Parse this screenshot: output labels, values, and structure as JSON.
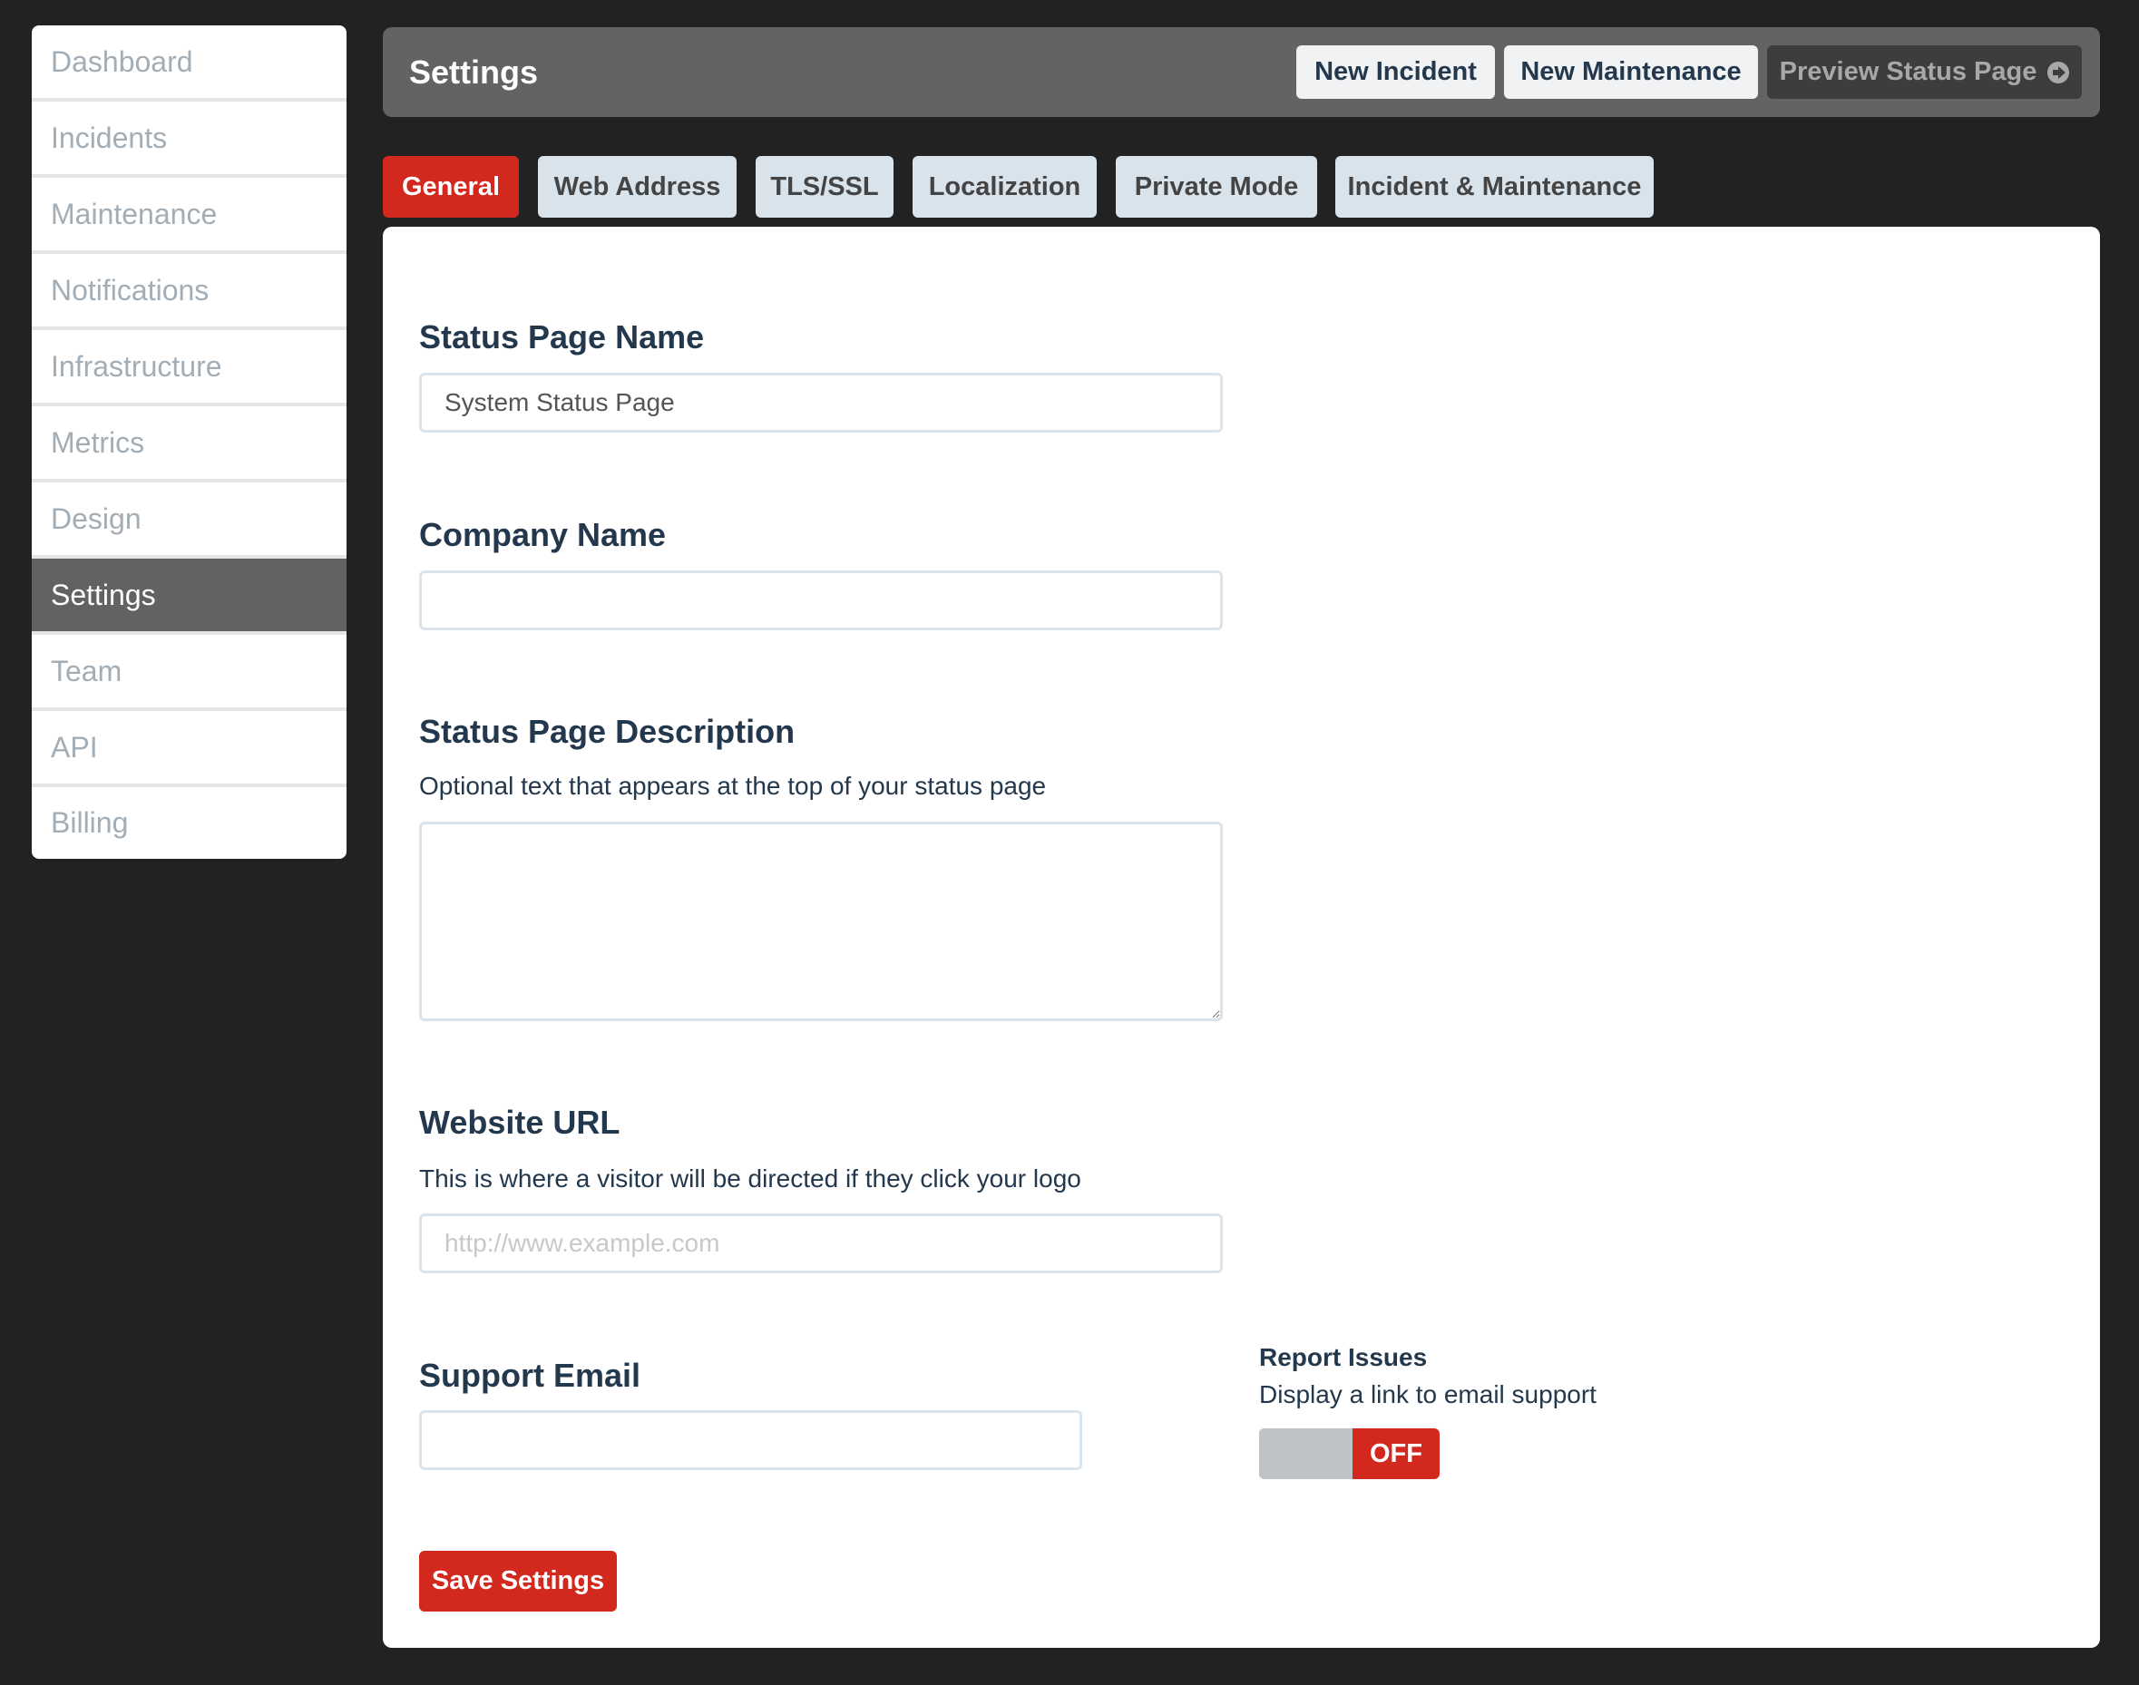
{
  "sidebar": {
    "items": [
      {
        "label": "Dashboard"
      },
      {
        "label": "Incidents"
      },
      {
        "label": "Maintenance"
      },
      {
        "label": "Notifications"
      },
      {
        "label": "Infrastructure"
      },
      {
        "label": "Metrics"
      },
      {
        "label": "Design"
      },
      {
        "label": "Settings",
        "active": true
      },
      {
        "label": "Team"
      },
      {
        "label": "API"
      },
      {
        "label": "Billing"
      }
    ]
  },
  "header": {
    "title": "Settings",
    "new_incident_label": "New Incident",
    "new_maintenance_label": "New Maintenance",
    "preview_label": "Preview Status Page",
    "preview_icon": "circle-arrow-right-icon"
  },
  "tabs": [
    {
      "label": "General",
      "active": true
    },
    {
      "label": "Web Address"
    },
    {
      "label": "TLS/SSL"
    },
    {
      "label": "Localization"
    },
    {
      "label": "Private Mode"
    },
    {
      "label": "Incident & Maintenance"
    }
  ],
  "form": {
    "status_page_name": {
      "label": "Status Page Name",
      "value": "System Status Page"
    },
    "company_name": {
      "label": "Company Name",
      "value": ""
    },
    "description": {
      "label": "Status Page Description",
      "help": "Optional text that appears at the top of your status page",
      "value": ""
    },
    "website_url": {
      "label": "Website URL",
      "help": "This is where a visitor will be directed if they click your logo",
      "value": "",
      "placeholder": "http://www.example.com"
    },
    "support_email": {
      "label": "Support Email",
      "value": ""
    },
    "report_issues": {
      "label": "Report Issues",
      "help": "Display a link to email support",
      "state": "OFF"
    },
    "save_label": "Save Settings"
  },
  "colors": {
    "accent": "#d2281e",
    "background": "#222222",
    "header_bg": "#636363",
    "heading_text": "#23384d"
  }
}
